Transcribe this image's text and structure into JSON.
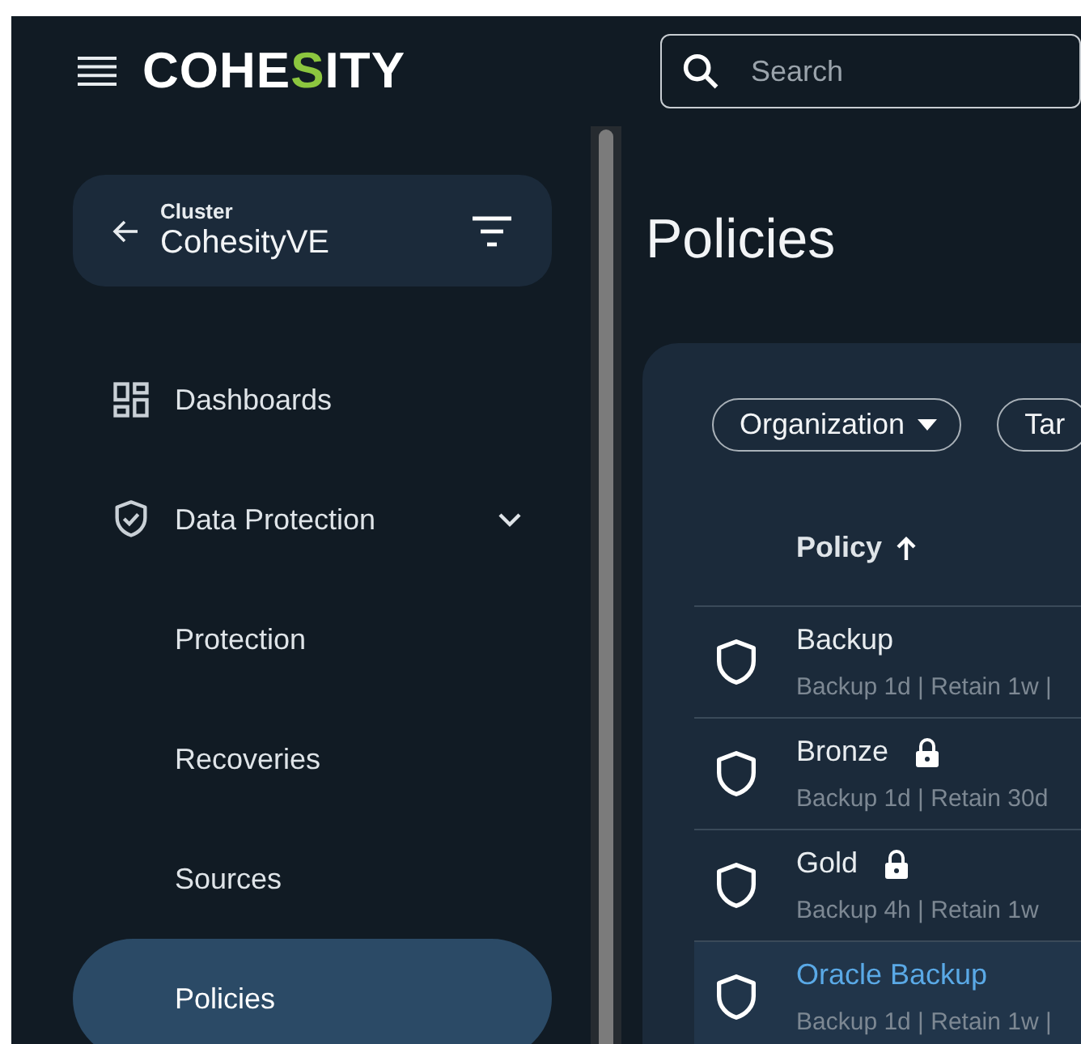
{
  "header": {
    "logo": [
      {
        "text": "COHE",
        "accent": false
      },
      {
        "text": "S",
        "accent": true
      },
      {
        "text": "ITY",
        "accent": false
      }
    ],
    "search": {
      "placeholder": "Search"
    }
  },
  "cluster": {
    "label": "Cluster",
    "name": "CohesityVE"
  },
  "nav": [
    {
      "label": "Dashboards",
      "kind": "dashboard",
      "selected": false
    },
    {
      "label": "Data Protection",
      "kind": "shield",
      "selected": false,
      "expanded": true,
      "children": [
        {
          "label": "Protection",
          "selected": false
        },
        {
          "label": "Recoveries",
          "selected": false
        },
        {
          "label": "Sources",
          "selected": false
        },
        {
          "label": "Policies",
          "selected": true
        }
      ]
    }
  ],
  "page": {
    "title": "Policies"
  },
  "filters": [
    {
      "label": "Organization",
      "dropdown": true
    },
    {
      "label": "Tar",
      "dropdown": false
    }
  ],
  "table": {
    "columns": [
      {
        "label": "Policy",
        "sort_ascending": true
      }
    ],
    "rows": [
      {
        "name": "Backup",
        "summary": "Backup 1d | Retain 1w |",
        "locked": false,
        "selected": false
      },
      {
        "name": "Bronze",
        "summary": "Backup 1d | Retain 30d",
        "locked": true,
        "selected": false
      },
      {
        "name": "Gold",
        "summary": "Backup 4h | Retain 1w",
        "locked": true,
        "selected": false
      },
      {
        "name": "Oracle Backup",
        "summary": "Backup 1d | Retain 1w |",
        "locked": false,
        "selected": true
      }
    ]
  }
}
